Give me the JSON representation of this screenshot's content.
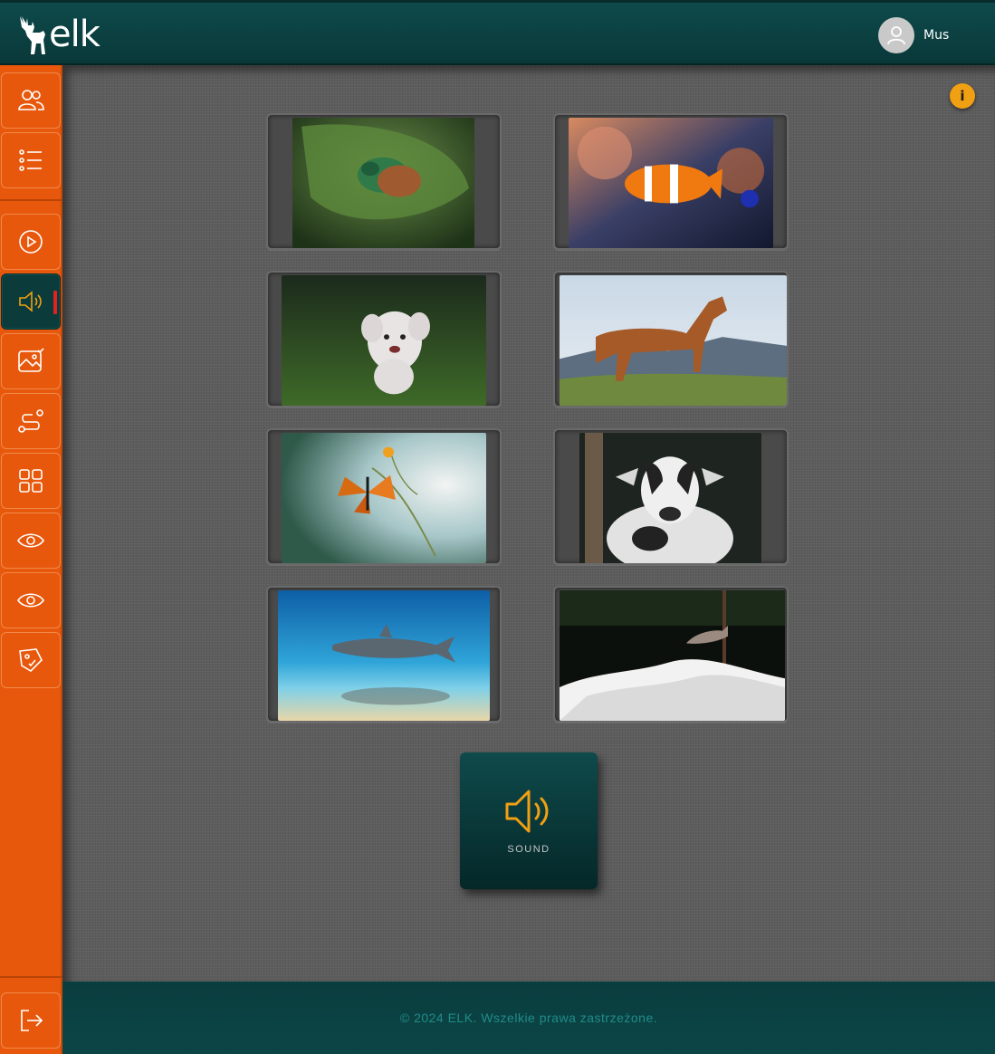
{
  "app": {
    "logo_text": "elk"
  },
  "header": {
    "user_name": "Mus"
  },
  "sidebar": {
    "items": [
      {
        "icon": "users-icon"
      },
      {
        "icon": "list-icon"
      },
      {
        "icon": "play-icon"
      },
      {
        "icon": "speaker-icon",
        "active": true
      },
      {
        "icon": "image-check-icon"
      },
      {
        "icon": "route-icon"
      },
      {
        "icon": "grid-icon"
      },
      {
        "icon": "eye-icon"
      },
      {
        "icon": "eye-icon"
      },
      {
        "icon": "tag-icon"
      }
    ],
    "logout_icon": "logout-icon"
  },
  "main": {
    "info_label": "i",
    "cards": [
      {
        "subject": "beetle"
      },
      {
        "subject": "clownfish"
      },
      {
        "subject": "dog"
      },
      {
        "subject": "horse"
      },
      {
        "subject": "butterfly"
      },
      {
        "subject": "goat"
      },
      {
        "subject": "shark"
      },
      {
        "subject": "salmon"
      }
    ],
    "sound_button": {
      "label": "SOUND",
      "icon": "speaker-icon"
    }
  },
  "footer": {
    "copyright": "© 2024 ELK. Wszelkie prawa zastrzeżone."
  },
  "colors": {
    "sidebar": "#e8580c",
    "header": "#0e4a4b",
    "accent": "#f0a012",
    "active_marker": "#e52020"
  }
}
